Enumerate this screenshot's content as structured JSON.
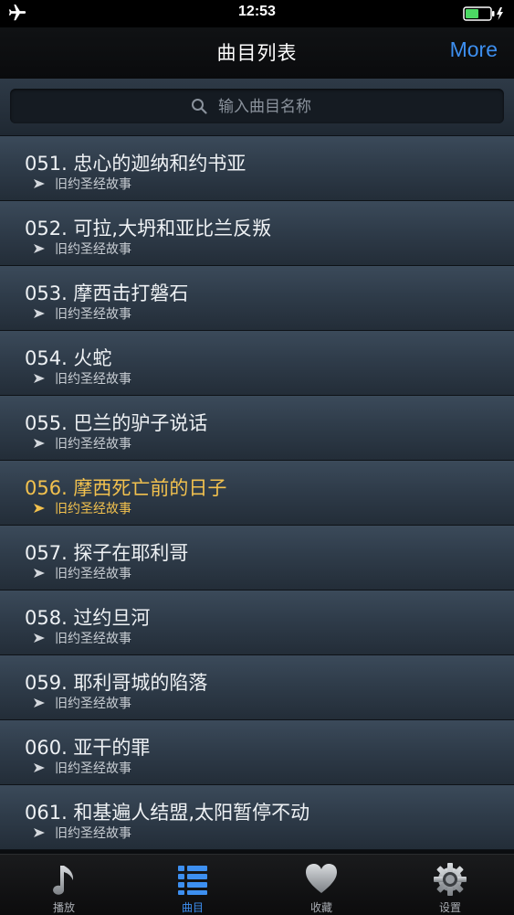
{
  "status": {
    "time": "12:53"
  },
  "nav": {
    "title": "曲目列表",
    "more_label": "More"
  },
  "search": {
    "placeholder": "输入曲目名称"
  },
  "colors": {
    "accent": "#3d8ff0",
    "active_item": "#f2c14e"
  },
  "items": [
    {
      "title": "051. 忠心的迦纳和约书亚",
      "subtitle": "旧约圣经故事"
    },
    {
      "title": "052. 可拉,大坍和亚比兰反叛",
      "subtitle": "旧约圣经故事"
    },
    {
      "title": "053. 摩西击打磐石",
      "subtitle": "旧约圣经故事"
    },
    {
      "title": "054. 火蛇",
      "subtitle": "旧约圣经故事"
    },
    {
      "title": "055. 巴兰的驴子说话",
      "subtitle": "旧约圣经故事"
    },
    {
      "title": "056. 摩西死亡前的日子",
      "subtitle": "旧约圣经故事",
      "active": true
    },
    {
      "title": "057. 探子在耶利哥",
      "subtitle": "旧约圣经故事"
    },
    {
      "title": "058. 过约旦河",
      "subtitle": "旧约圣经故事"
    },
    {
      "title": "059. 耶利哥城的陷落",
      "subtitle": "旧约圣经故事"
    },
    {
      "title": "060. 亚干的罪",
      "subtitle": "旧约圣经故事"
    },
    {
      "title": "061. 和基遍人结盟,太阳暂停不动",
      "subtitle": "旧约圣经故事"
    }
  ],
  "tabs": [
    {
      "label": "播放",
      "icon": "music-note-icon"
    },
    {
      "label": "曲目",
      "icon": "list-icon",
      "selected": true
    },
    {
      "label": "收藏",
      "icon": "heart-icon"
    },
    {
      "label": "设置",
      "icon": "gear-icon"
    }
  ]
}
